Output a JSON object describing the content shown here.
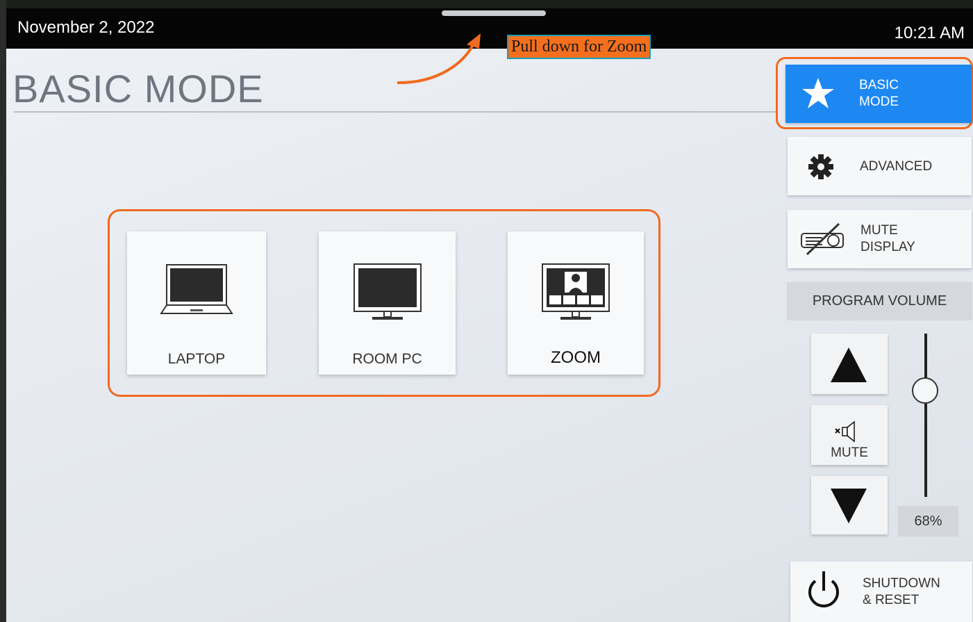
{
  "status_bar": {
    "date": "November 2, 2022",
    "time": "10:21 AM"
  },
  "annotation": {
    "text": "Pull down for Zoom"
  },
  "page": {
    "title": "BASIC MODE"
  },
  "sources": [
    {
      "label": "LAPTOP",
      "icon": "laptop-icon"
    },
    {
      "label": "ROOM PC",
      "icon": "monitor-icon"
    },
    {
      "label": "ZOOM",
      "icon": "zoom-display-icon"
    }
  ],
  "sidebar": {
    "basic_mode": {
      "line1": "BASIC",
      "line2": "MODE",
      "icon": "star-icon"
    },
    "advanced": {
      "label": "ADVANCED",
      "icon": "gear-icon"
    },
    "mute_display": {
      "line1": "MUTE",
      "line2": "DISPLAY",
      "icon": "projector-muted-icon"
    },
    "shutdown": {
      "line1": "SHUTDOWN",
      "line2": "& RESET",
      "icon": "power-icon"
    }
  },
  "volume": {
    "header": "PROGRAM VOLUME",
    "mute_label": "MUTE",
    "level_text": "68%",
    "level": 0.68
  },
  "colors": {
    "accent": "#1e88f2",
    "highlight": "#f06a1f",
    "topbar": "#050505"
  }
}
